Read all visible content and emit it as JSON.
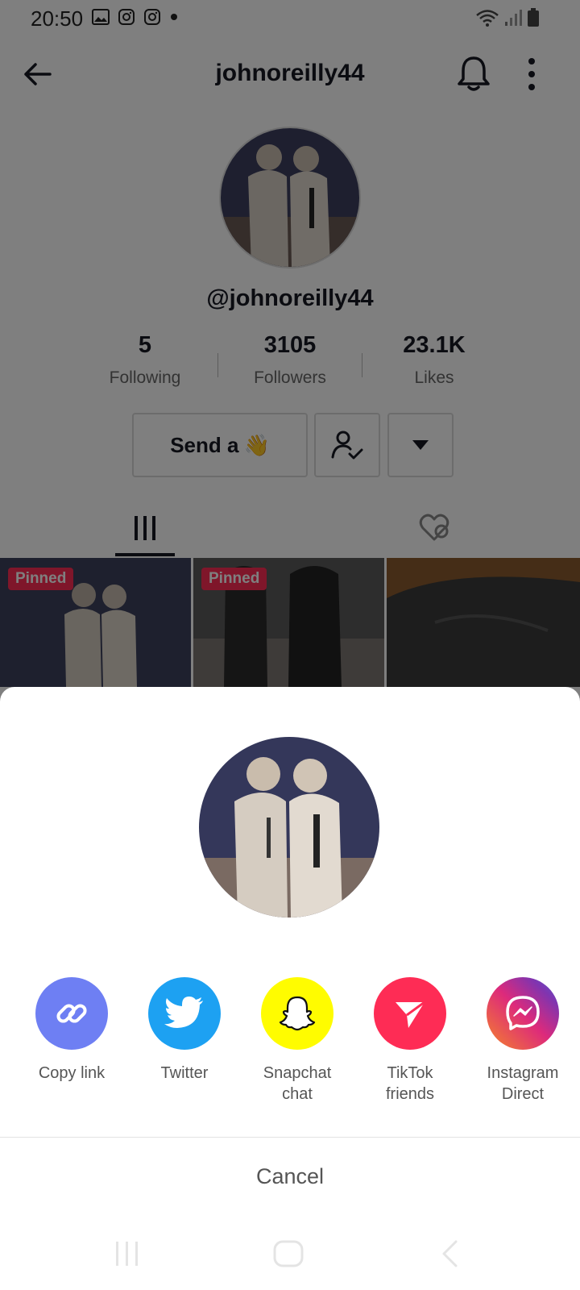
{
  "status_bar": {
    "time": "20:50",
    "left_icons": [
      "image-icon",
      "instagram-icon",
      "instagram-icon",
      "dot-icon"
    ],
    "right_icons": [
      "wifi-icon",
      "signal-icon",
      "battery-icon"
    ]
  },
  "header": {
    "title": "johnoreilly44",
    "back_icon": "back-arrow-icon",
    "bell_icon": "bell-icon",
    "more_icon": "more-vertical-icon"
  },
  "profile": {
    "handle": "@johnoreilly44",
    "stats": [
      {
        "value": "5",
        "label": "Following"
      },
      {
        "value": "3105",
        "label": "Followers"
      },
      {
        "value": "23.1K",
        "label": "Likes"
      }
    ],
    "send_label": "Send a",
    "send_emoji": "👋"
  },
  "tabs": {
    "videos_icon": "grid-icon",
    "liked_icon": "liked-hidden-icon"
  },
  "videos": [
    {
      "badge": "Pinned"
    },
    {
      "badge": "Pinned"
    },
    {
      "badge": ""
    }
  ],
  "share_sheet": {
    "targets": [
      {
        "label": "Copy link",
        "icon": "link-icon",
        "color": "#6e7ff3"
      },
      {
        "label": "Twitter",
        "icon": "twitter-icon",
        "color": "#1da1f2"
      },
      {
        "label": "Snapchat\nchat",
        "icon": "snapchat-icon",
        "color": "#fffc00"
      },
      {
        "label": "TikTok\nfriends",
        "icon": "send-icon",
        "color": "#fe2c55"
      },
      {
        "label": "Instagram\nDirect",
        "icon": "messenger-icon",
        "color": "#c13584"
      }
    ],
    "cancel_label": "Cancel"
  },
  "colors": {
    "accent": "#fe2c55",
    "text": "#161823"
  }
}
